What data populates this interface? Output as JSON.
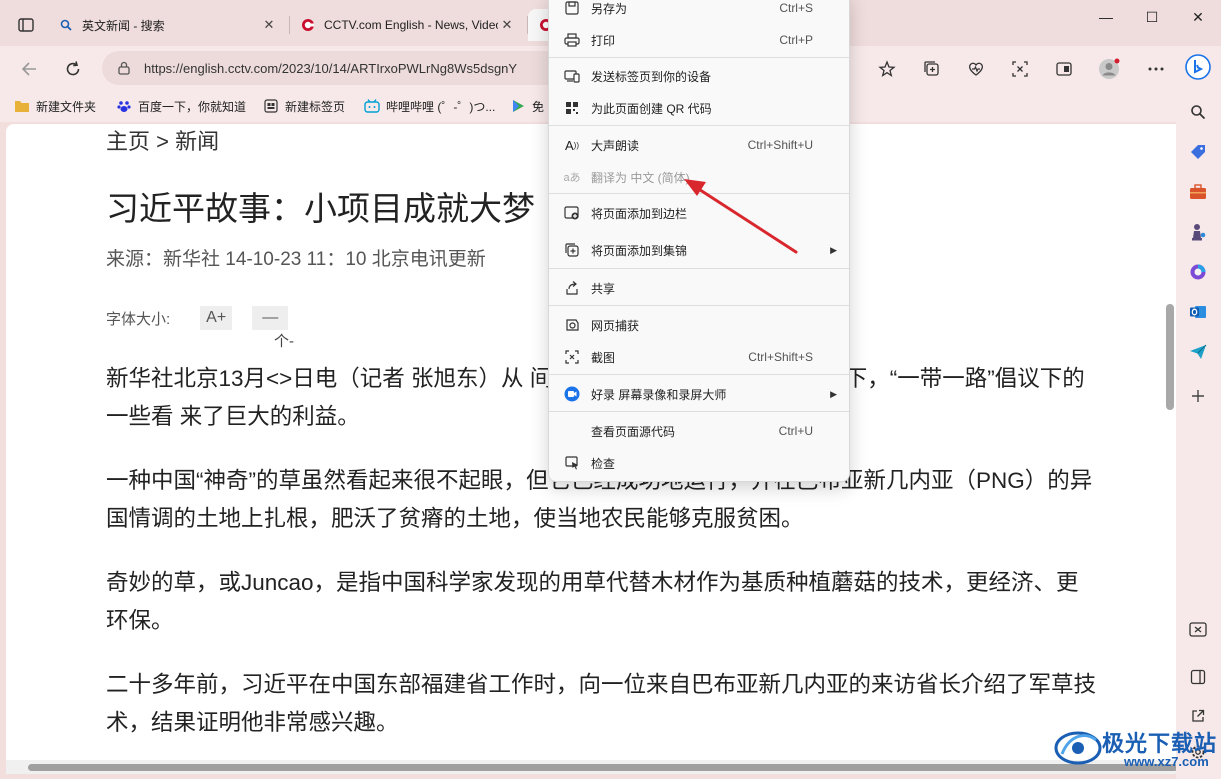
{
  "tabs": [
    {
      "title": "英文新闻 - 搜索",
      "close": "✕",
      "icon": "search-icon"
    },
    {
      "title": "CCTV.com English - News, Video",
      "close": "✕",
      "icon": "cctv-icon"
    }
  ],
  "window": {
    "minimize": "—",
    "maximize": "☐",
    "close": "✕"
  },
  "toolbar": {
    "url": "https://english.cctv.com/2023/10/14/ARTIrxoPWLrNg8Ws5dsgnY"
  },
  "bookmarks": [
    {
      "label": "新建文件夹",
      "icon": "folder-icon"
    },
    {
      "label": "百度一下，你就知道",
      "icon": "baidu-icon"
    },
    {
      "label": "新建标签页",
      "icon": "newtab-icon"
    },
    {
      "label": "哔哩哔哩 (゜-゜)つ...",
      "icon": "bilibili-icon"
    },
    {
      "label": "免",
      "icon": "play-icon"
    }
  ],
  "article": {
    "breadcrumb": "主页 > 新闻",
    "headline": "习近平故事：小项目成就大梦",
    "source": "来源：新华社 14-10-23 11：10 北京电讯更新",
    "fontsize_label": "字体大小:",
    "fontsize_up": "A+",
    "fontsize_down": "—",
    "fontsize_hint": "个-",
    "paragraphs": [
      "新华社北京13月<>日电（记者 张旭东）从 间，在习近平主席的关心和支持下，“一带一路”倡议下的一些看 来了巨大的利益。",
      "一种中国“神奇”的草虽然看起来很不起眼，但它已经成功地运行，并在巴布亚新几内亚（PNG）的异国情调的土地上扎根，肥沃了贫瘠的土地，使当地农民能够克服贫困。",
      "奇妙的草，或Juncao，是指中国科学家发现的用草代替木材作为基质种植蘑菇的技术，更经济、更环保。",
      "二十多年前，习近平在中国东部福建省工作时，向一位来自巴布亚新几内亚的来访省长介绍了军草技术，结果证明他非常感兴趣。"
    ]
  },
  "context_menu": {
    "items": [
      {
        "label": "另存为",
        "shortcut": "Ctrl+S",
        "icon": "save-icon"
      },
      {
        "label": "打印",
        "shortcut": "Ctrl+P",
        "icon": "print-icon"
      },
      {
        "label": "发送标签页到你的设备",
        "shortcut": "",
        "icon": "send-device-icon"
      },
      {
        "label": "为此页面创建 QR 代码",
        "shortcut": "",
        "icon": "qr-icon"
      },
      {
        "label": "大声朗读",
        "shortcut": "Ctrl+Shift+U",
        "icon": "read-aloud-icon"
      },
      {
        "label": "翻译为 中文 (简体)",
        "shortcut": "",
        "icon": "translate-icon"
      },
      {
        "label": "将页面添加到边栏",
        "shortcut": "",
        "icon": "sidebar-add-icon"
      },
      {
        "label": "将页面添加到集锦",
        "shortcut": "",
        "icon": "collections-icon"
      },
      {
        "label": "共享",
        "shortcut": "",
        "icon": "share-icon"
      },
      {
        "label": "网页捕获",
        "shortcut": "",
        "icon": "web-capture-icon"
      },
      {
        "label": "截图",
        "shortcut": "Ctrl+Shift+S",
        "icon": "screenshot-icon"
      },
      {
        "label": "好录 屏幕录像和录屏大师",
        "shortcut": "",
        "icon": "recorder-icon"
      },
      {
        "label": "查看页面源代码",
        "shortcut": "Ctrl+U",
        "icon": ""
      },
      {
        "label": "检查",
        "shortcut": "",
        "icon": "inspect-icon"
      }
    ]
  },
  "watermark": {
    "text": "极光下载站",
    "url": "www.xz7.com"
  },
  "colors": {
    "accent": "#1a73e8",
    "arrow": "#d9272e",
    "titlebar": "#efdcdc"
  }
}
